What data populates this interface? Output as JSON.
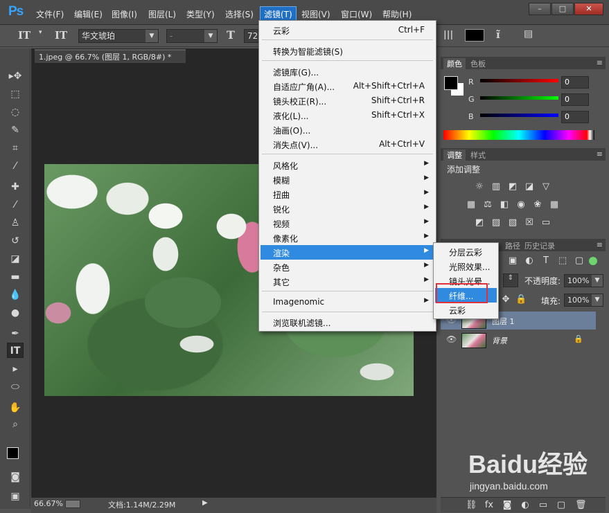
{
  "app": {
    "logo": "Ps"
  },
  "menubar": {
    "items": [
      "文件(F)",
      "编辑(E)",
      "图像(I)",
      "图层(L)",
      "类型(Y)",
      "选择(S)",
      "滤镜(T)",
      "视图(V)",
      "窗口(W)",
      "帮助(H)"
    ],
    "active_index": 6
  },
  "window_controls": [
    "–",
    "□",
    "✕"
  ],
  "options_bar": {
    "font_family": "华文琥珀",
    "font_style": "-",
    "font_size": "72"
  },
  "document": {
    "tab_title": "1.jpeg @ 66.7% (图层 1, RGB/8#) *",
    "zoom": "66.67%",
    "doc_size": "文档:1.14M/2.29M"
  },
  "filter_menu": {
    "items": [
      {
        "label": "云彩",
        "shortcut": "Ctrl+F"
      },
      {
        "label": "转换为智能滤镜(S)",
        "shortcut": ""
      },
      {
        "label": "滤镜库(G)...",
        "shortcut": ""
      },
      {
        "label": "自适应广角(A)...",
        "shortcut": "Alt+Shift+Ctrl+A"
      },
      {
        "label": "镜头校正(R)...",
        "shortcut": "Shift+Ctrl+R"
      },
      {
        "label": "液化(L)...",
        "shortcut": "Shift+Ctrl+X"
      },
      {
        "label": "油画(O)...",
        "shortcut": ""
      },
      {
        "label": "消失点(V)...",
        "shortcut": "Alt+Ctrl+V"
      },
      {
        "label": "风格化",
        "shortcut": ""
      },
      {
        "label": "模糊",
        "shortcut": ""
      },
      {
        "label": "扭曲",
        "shortcut": ""
      },
      {
        "label": "锐化",
        "shortcut": ""
      },
      {
        "label": "视频",
        "shortcut": ""
      },
      {
        "label": "像素化",
        "shortcut": ""
      },
      {
        "label": "渲染",
        "shortcut": ""
      },
      {
        "label": "杂色",
        "shortcut": ""
      },
      {
        "label": "其它",
        "shortcut": ""
      },
      {
        "label": "Imagenomic",
        "shortcut": ""
      },
      {
        "label": "浏览联机滤镜...",
        "shortcut": ""
      }
    ]
  },
  "render_submenu": {
    "items": [
      "分层云彩",
      "光照效果...",
      "镜头光晕...",
      "纤维...",
      "云彩"
    ]
  },
  "color_panel": {
    "tabs": [
      "颜色",
      "色板"
    ],
    "channels": [
      {
        "label": "R",
        "value": "0",
        "color": "#d22020"
      },
      {
        "label": "G",
        "value": "0",
        "color": "#1ea51e"
      },
      {
        "label": "B",
        "value": "0",
        "color": "#1f2fd6"
      }
    ]
  },
  "adjust_panel": {
    "tabs": [
      "调整",
      "样式"
    ],
    "title": "添加调整"
  },
  "layers_panel": {
    "tabs": [
      "路径",
      "历史记录"
    ],
    "opacity_label": "不透明度:",
    "opacity_value": "100%",
    "fill_label": "填充:",
    "fill_value": "100%",
    "layers": [
      {
        "name": "图层 1",
        "selected": true,
        "locked": false
      },
      {
        "name": "背景",
        "selected": false,
        "locked": true
      }
    ]
  },
  "watermark": {
    "text": "Baidu经验",
    "url": "jingyan.baidu.com"
  }
}
